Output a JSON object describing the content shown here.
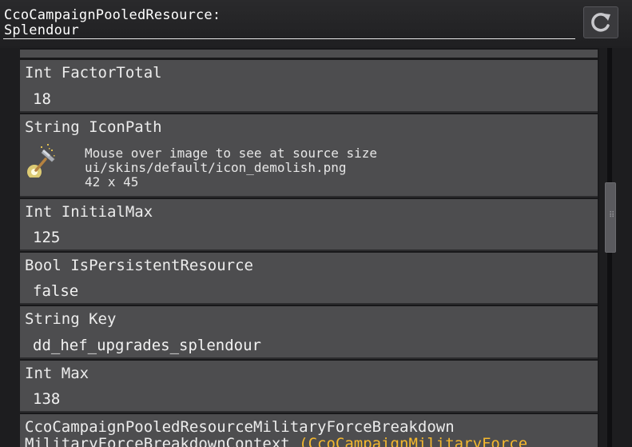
{
  "header": {
    "title_line1": "CcoCampaignPooledResource:",
    "title_line2": "Splendour",
    "refresh_icon": "refresh-icon"
  },
  "fields": [
    {
      "type_name": "Int FactorTotal",
      "value": "18"
    },
    {
      "type_name": "String IconPath",
      "image": {
        "icon": "hammer-icon",
        "hint": "Mouse over image to see at source size",
        "path": "ui/skins/default/icon_demolish.png",
        "dims": "42 x 45"
      }
    },
    {
      "type_name": "Int InitialMax",
      "value": "125"
    },
    {
      "type_name": "Bool IsPersistentResource",
      "value": "false"
    },
    {
      "type_name": "String Key",
      "value": "dd_hef_upgrades_splendour"
    },
    {
      "type_name": "Int Max",
      "value": "138"
    }
  ],
  "last_field": {
    "line1": "CcoCampaignPooledResourceMilitaryForceBreakdown",
    "line2_prefix": "MilitaryForceBreakdownContext ",
    "line2_link": "(CcoCampaignMilitaryForce"
  },
  "colors": {
    "link": "#f5b82e",
    "row_bg": "#4d4d4f",
    "window_bg": "#1d1d1f"
  }
}
